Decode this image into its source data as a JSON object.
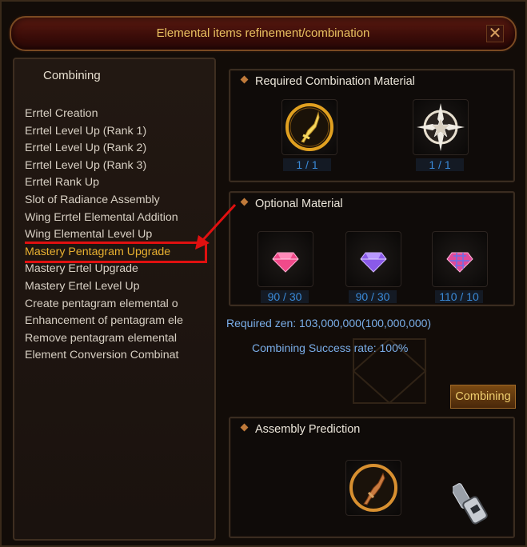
{
  "window": {
    "title": "Elemental items refinement/combination",
    "close_label": "✕"
  },
  "left": {
    "header": "Combining",
    "items": [
      "Errtel Creation",
      "Errtel Level Up (Rank 1)",
      "Errtel Level Up (Rank 2)",
      "Errtel Level Up (Rank 3)",
      "Errtel Rank Up",
      "Slot of Radiance Assembly",
      "Wing Errtel Elemental Addition",
      "Wing Elemental Level Up",
      "Mastery Pentagram Upgrade",
      "Mastery Ertel Upgrade",
      "Mastery Ertel Level Up",
      "Create pentagram elemental o",
      "Enhancement of pentagram ele",
      "Remove pentagram elemental",
      "Element Conversion Combinat"
    ],
    "selected_index": 8
  },
  "required": {
    "header": "Required Combination Material",
    "slots": [
      {
        "icon": "golden-dagger-icon",
        "count": "1 / 1"
      },
      {
        "icon": "pentagram-compass-icon",
        "count": "1 / 1"
      }
    ]
  },
  "optional": {
    "header": "Optional Material",
    "slots": [
      {
        "icon": "pink-gem-icon",
        "count": "90 / 30"
      },
      {
        "icon": "purple-gem-icon",
        "count": "90 / 30"
      },
      {
        "icon": "pink-plaid-gem-icon",
        "count": "110 / 10"
      }
    ]
  },
  "summary": {
    "zen": "Required zen: 103,000,000(100,000,000)",
    "rate": "Combining Success rate: 100%"
  },
  "combine_button": "Combining",
  "prediction": {
    "header": "Assembly Prediction",
    "icon": "bronze-dagger-icon"
  },
  "colors": {
    "title_text": "#e8c060",
    "count_text": "#3a8ad8",
    "info_text": "#7aaee8",
    "highlight_box": "#e01010",
    "selected_text": "#e8b030"
  }
}
